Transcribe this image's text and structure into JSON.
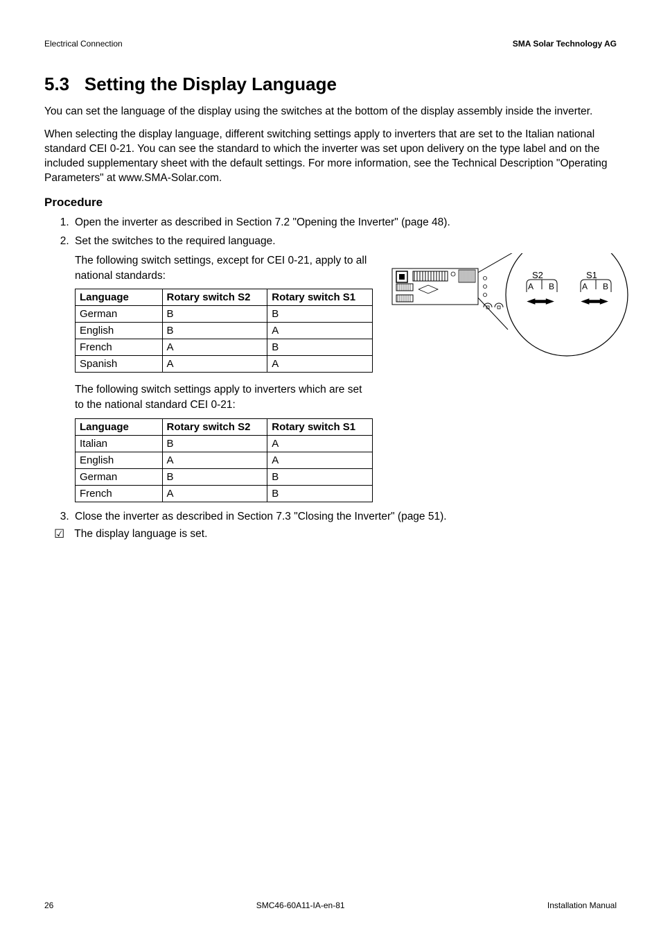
{
  "header": {
    "left": "Electrical Connection",
    "right": "SMA Solar Technology AG"
  },
  "section": {
    "number": "5.3",
    "title": "Setting the Display Language"
  },
  "paragraphs": {
    "p1": "You can set the language of the display using the switches at the bottom of the display assembly inside the inverter.",
    "p2": "When selecting the display language, different switching settings apply to inverters that are set to the Italian national standard CEI 0-21. You can see the standard to which the inverter was set upon delivery on the type label and on the included supplementary sheet with the default settings. For more information, see the Technical Description \"Operating Parameters\" at www.SMA-Solar.com."
  },
  "procedure": {
    "heading": "Procedure",
    "step1": "Open the inverter as described in Section 7.2 \"Opening the Inverter\" (page 48).",
    "step2": "Set the switches to the required language.",
    "sub_a": "The following switch settings, except for CEI 0-21, apply to all national standards:",
    "sub_b": "The following switch settings apply to inverters which are set to the national standard CEI 0-21:",
    "step3": "Close the inverter as described in Section 7.3 \"Closing the Inverter\" (page 51).",
    "done": "The display language is set."
  },
  "table_headers": {
    "lang": "Language",
    "s2": "Rotary switch S2",
    "s1": "Rotary switch S1"
  },
  "table1": [
    {
      "lang": "German",
      "s2": "B",
      "s1": "B"
    },
    {
      "lang": "English",
      "s2": "B",
      "s1": "A"
    },
    {
      "lang": "French",
      "s2": "A",
      "s1": "B"
    },
    {
      "lang": "Spanish",
      "s2": "A",
      "s1": "A"
    }
  ],
  "table2": [
    {
      "lang": "Italian",
      "s2": "B",
      "s1": "A"
    },
    {
      "lang": "English",
      "s2": "A",
      "s1": "A"
    },
    {
      "lang": "German",
      "s2": "B",
      "s1": "B"
    },
    {
      "lang": "French",
      "s2": "A",
      "s1": "B"
    }
  ],
  "diagram": {
    "labels": {
      "s2": "S2",
      "s1": "S1",
      "a": "A",
      "b": "B"
    }
  },
  "footer": {
    "page": "26",
    "doc": "SMC46-60A11-IA-en-81",
    "right": "Installation Manual"
  }
}
